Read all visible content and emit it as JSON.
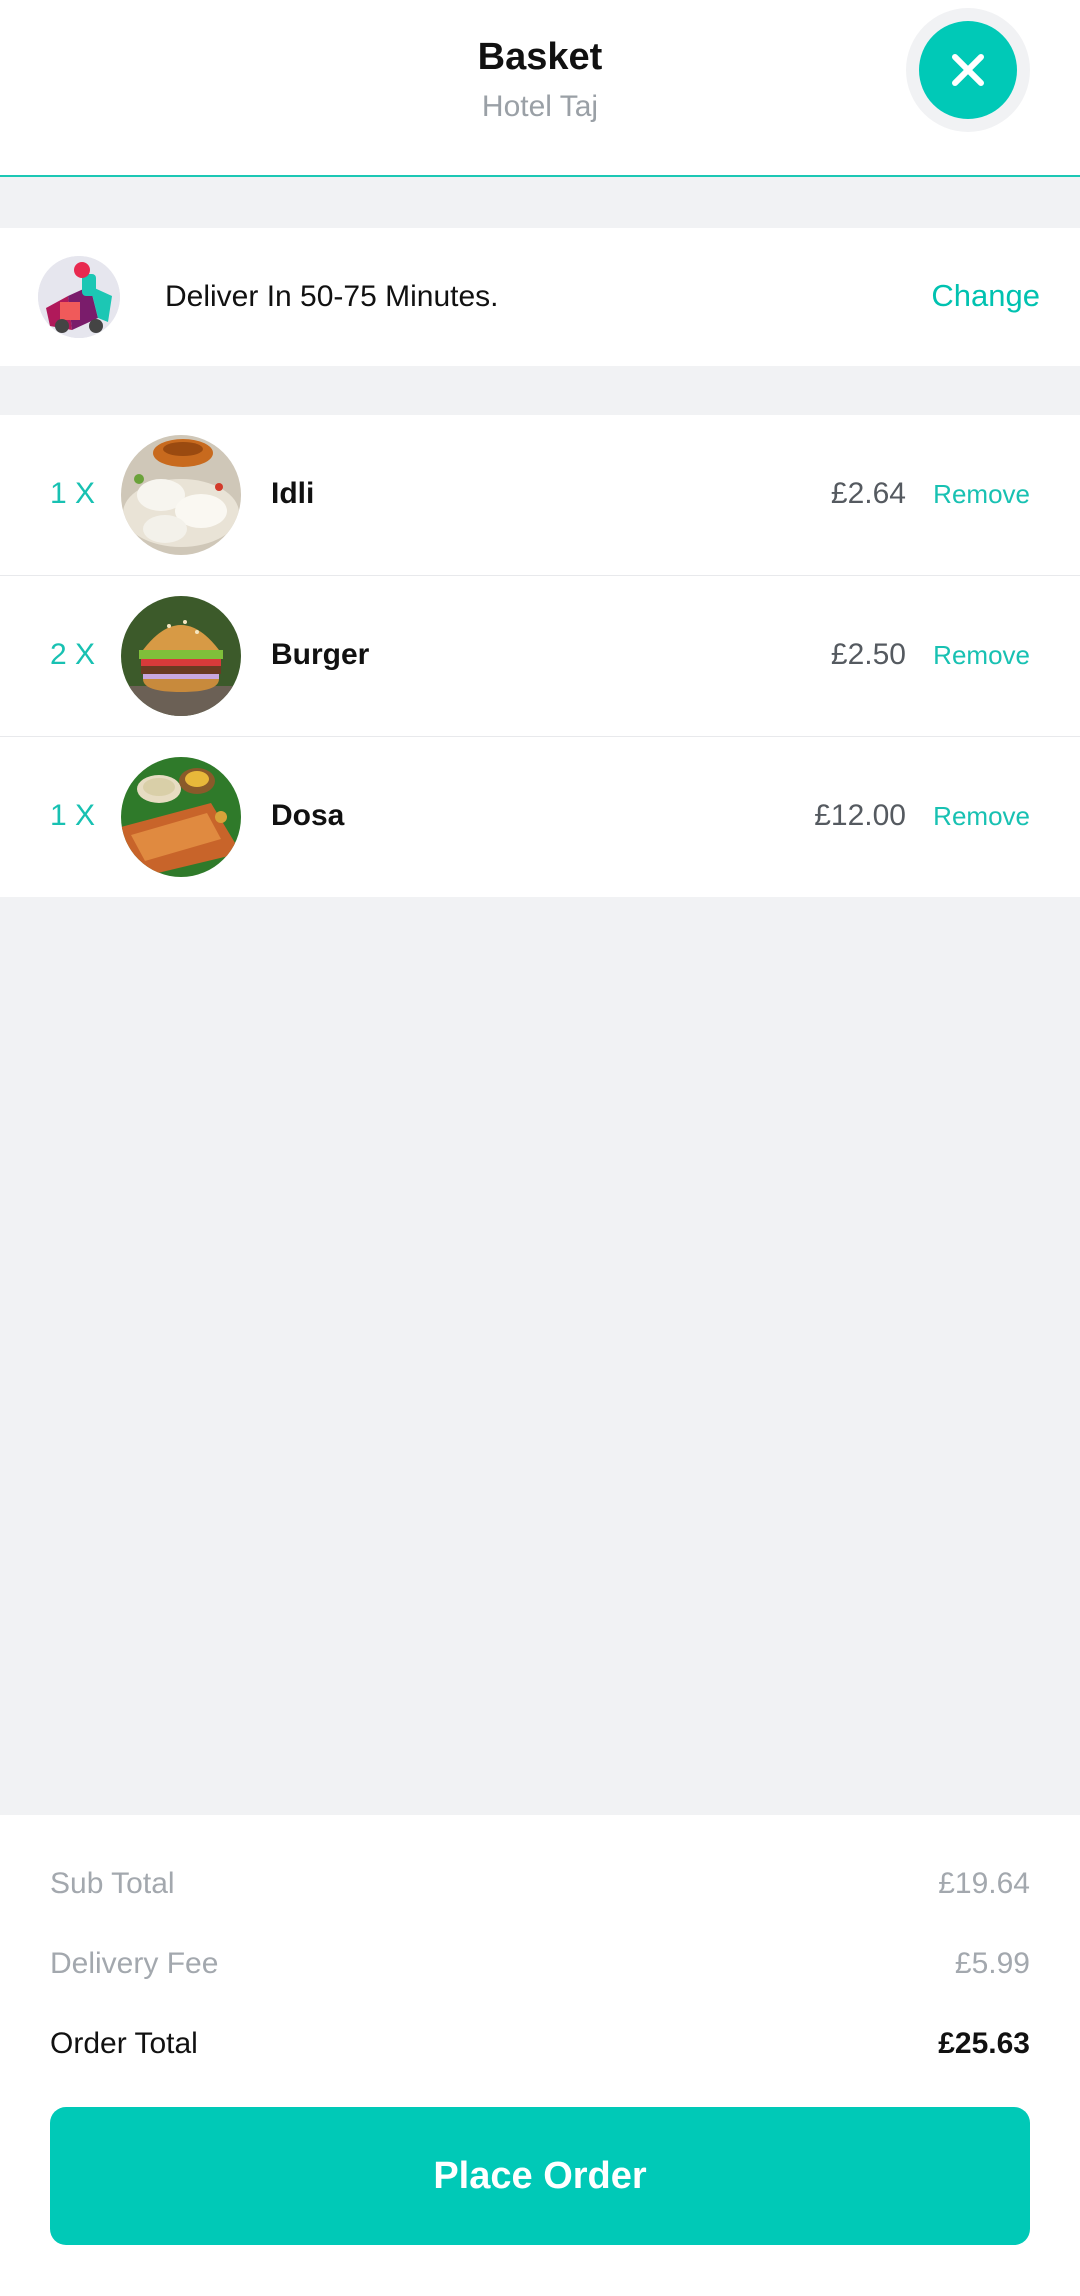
{
  "header": {
    "title": "Basket",
    "subtitle": "Hotel Taj",
    "close_icon": "close-icon"
  },
  "delivery": {
    "icon": "delivery-rider-icon",
    "text": "Deliver In 50-75 Minutes.",
    "change_label": "Change"
  },
  "items": [
    {
      "qty": "1 X",
      "name": "Idli",
      "price": "£2.64",
      "remove_label": "Remove",
      "image": "idli-image"
    },
    {
      "qty": "2 X",
      "name": "Burger",
      "price": "£2.50",
      "remove_label": "Remove",
      "image": "burger-image"
    },
    {
      "qty": "1 X",
      "name": "Dosa",
      "price": "£12.00",
      "remove_label": "Remove",
      "image": "dosa-image"
    }
  ],
  "summary": {
    "subtotal_label": "Sub Total",
    "subtotal_value": "£19.64",
    "delivery_fee_label": "Delivery Fee",
    "delivery_fee_value": "£5.99",
    "order_total_label": "Order Total",
    "order_total_value": "£25.63"
  },
  "place_order_label": "Place Order",
  "colors": {
    "accent": "#00c9b7",
    "background": "#f1f2f4"
  }
}
